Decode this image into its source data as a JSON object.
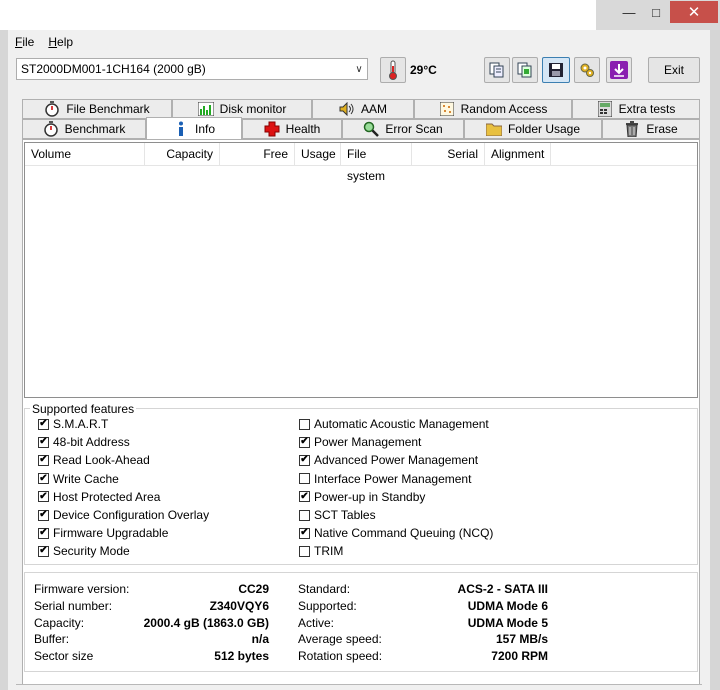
{
  "menu": {
    "file": "File",
    "file_accel": "F",
    "file_rest": "ile",
    "help_accel": "H",
    "help_rest": "elp"
  },
  "toolbar": {
    "drive": "ST2000DM001-1CH164 (2000 gB)",
    "temperature": "29°C",
    "exit_label": "Exit"
  },
  "tabs_top": [
    "File Benchmark",
    "Disk monitor",
    "AAM",
    "Random Access",
    "Extra tests"
  ],
  "tabs_bottom": [
    "Benchmark",
    "Info",
    "Health",
    "Error Scan",
    "Folder Usage",
    "Erase"
  ],
  "active_tab": "Info",
  "volume_columns": [
    "Volume",
    "Capacity",
    "Free",
    "Usage",
    "File system",
    "Serial",
    "Alignment"
  ],
  "features": {
    "title": "Supported features",
    "left": [
      {
        "label": "S.M.A.R.T",
        "checked": true
      },
      {
        "label": "48-bit Address",
        "checked": true
      },
      {
        "label": "Read Look-Ahead",
        "checked": true
      },
      {
        "label": "Write Cache",
        "checked": true
      },
      {
        "label": "Host Protected Area",
        "checked": true
      },
      {
        "label": "Device Configuration Overlay",
        "checked": true
      },
      {
        "label": "Firmware Upgradable",
        "checked": true
      },
      {
        "label": "Security Mode",
        "checked": true
      }
    ],
    "right": [
      {
        "label": "Automatic Acoustic Management",
        "checked": false
      },
      {
        "label": "Power Management",
        "checked": true
      },
      {
        "label": "Advanced Power Management",
        "checked": true
      },
      {
        "label": "Interface Power Management",
        "checked": false
      },
      {
        "label": "Power-up in Standby",
        "checked": true
      },
      {
        "label": "SCT Tables",
        "checked": false
      },
      {
        "label": "Native Command Queuing (NCQ)",
        "checked": true
      },
      {
        "label": "TRIM",
        "checked": false
      }
    ]
  },
  "info": {
    "left": [
      {
        "label": "Firmware version:",
        "value": "CC29"
      },
      {
        "label": "Serial number:",
        "value": "Z340VQY6"
      },
      {
        "label": "Capacity:",
        "value": "2000.4 gB (1863.0 GB)"
      },
      {
        "label": "Buffer:",
        "value": "n/a"
      },
      {
        "label": "Sector size",
        "value": "512 bytes"
      }
    ],
    "right": [
      {
        "label": "Standard:",
        "value": "ACS-2 - SATA III"
      },
      {
        "label": "Supported:",
        "value": "UDMA Mode 6"
      },
      {
        "label": "Active:",
        "value": "UDMA Mode 5"
      },
      {
        "label": "Average speed:",
        "value": "157 MB/s"
      },
      {
        "label": "Rotation speed:",
        "value": "7200 RPM"
      }
    ]
  },
  "colors": {
    "accent_purple": "#8a1fb0",
    "close_red": "#c7504a"
  }
}
